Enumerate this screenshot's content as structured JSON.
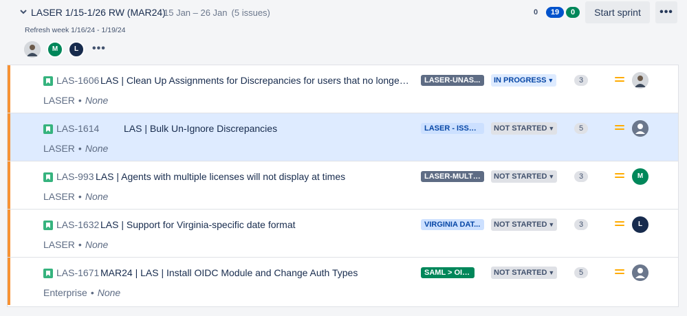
{
  "sprint": {
    "title": "LASER 1/15-1/26 RW (MAR24)",
    "dates": "15 Jan – 26 Jan",
    "issue_count": "(5 issues)",
    "goal": "Refresh week 1/16/24 - 1/19/24",
    "counts": {
      "todo": "0",
      "in_progress": "19",
      "done": "0"
    },
    "start_label": "Start sprint",
    "more_label": "•••",
    "members": [
      {
        "initial": "",
        "type": "photo"
      },
      {
        "initial": "M",
        "color": "#00875a"
      },
      {
        "initial": "L",
        "color": "#172b4d"
      }
    ],
    "members_more": "•••"
  },
  "issues": [
    {
      "key": "LAS-1606",
      "summary": "LAS | Clean Up Assignments for Discrepancies for users that no longer ...",
      "project": "LASER",
      "fix_version": "None",
      "label": "LASER-UNAS...",
      "label_bg": "#5e6c84",
      "label_fg": "#ffffff",
      "status": "IN PROGRESS",
      "estimate": "3",
      "assignee": ""
    },
    {
      "key": "LAS-1614",
      "summary": "LAS | Bulk Un-Ignore Discrepancies",
      "project": "LASER",
      "fix_version": "None",
      "label": "LASER - ISSUE...",
      "label_bg": "#cce0ff",
      "label_fg": "#0747a6",
      "status": "NOT STARTED",
      "estimate": "5",
      "assignee": ""
    },
    {
      "key": "LAS-993",
      "summary": "LAS | Agents with multiple licenses will not display at times",
      "project": "LASER",
      "fix_version": "None",
      "label": "LASER-MULTI...",
      "label_bg": "#5e6c84",
      "label_fg": "#ffffff",
      "status": "NOT STARTED",
      "estimate": "3",
      "assignee": "M"
    },
    {
      "key": "LAS-1632",
      "summary": "LAS | Support for Virginia-specific date format",
      "project": "LASER",
      "fix_version": "None",
      "label": "VIRGINIA DAT...",
      "label_bg": "#cce0ff",
      "label_fg": "#0747a6",
      "status": "NOT STARTED",
      "estimate": "3",
      "assignee": "L"
    },
    {
      "key": "LAS-1671",
      "summary": "MAR24 | LAS | Install OIDC Module and Change Auth Types",
      "project": "Enterprise",
      "fix_version": "None",
      "label": "SAML > OIDC",
      "label_bg": "#00875a",
      "label_fg": "#ffffff",
      "status": "NOT STARTED",
      "estimate": "5",
      "assignee": ""
    }
  ],
  "colors": {
    "epic_stripe": "#f79233",
    "priority_medium": "#ffab00",
    "story_icon": "#36b37e",
    "selected_row": "#deebff"
  },
  "icons": {
    "collapse": "chevron-down-icon",
    "story": "story-icon",
    "priority": "priority-medium-icon",
    "status_dropdown": "chevron-down-icon"
  }
}
